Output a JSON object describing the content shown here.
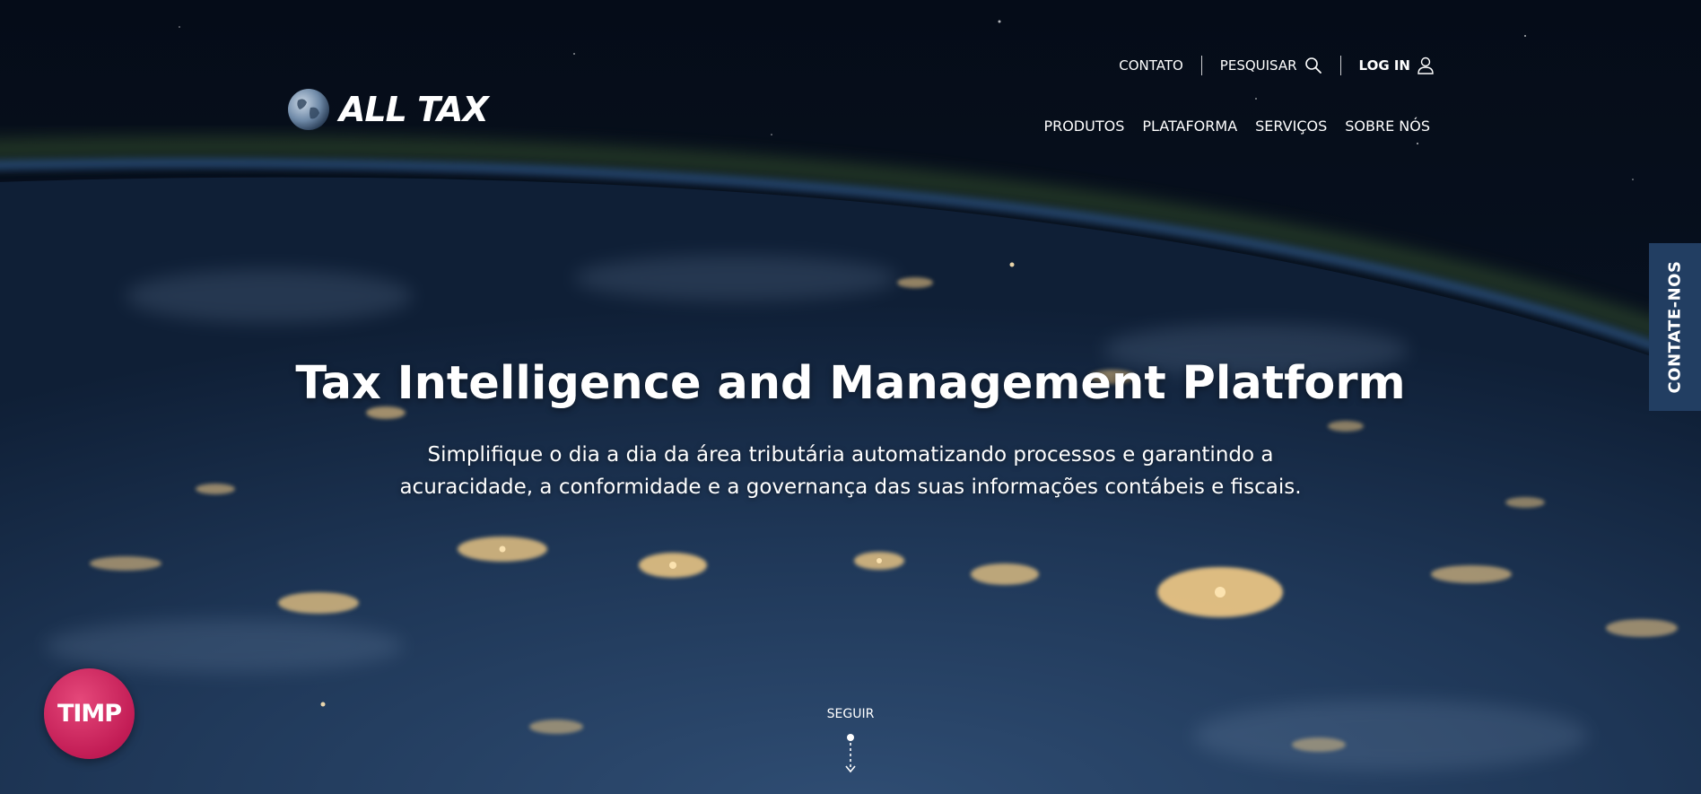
{
  "brand": {
    "name": "ALL TAX"
  },
  "util_nav": {
    "contact_label": "CONTATO",
    "search_label": "PESQUISAR",
    "login_label": "LOG IN"
  },
  "main_nav": {
    "items": [
      "PRODUTOS",
      "PLATAFORMA",
      "SERVIÇOS",
      "SOBRE NÓS"
    ]
  },
  "hero": {
    "title": "Tax Intelligence and Management Platform",
    "subtitle_line1": "Simplifique o dia a dia da área tributária automatizando processos e garantindo a",
    "subtitle_line2": "acuracidade, a conformidade e a governança das suas informações contábeis e fiscais."
  },
  "side_tab": {
    "label": "CONTATE-NOS"
  },
  "timp_badge": {
    "label": "TIMP"
  },
  "scroll_cue": {
    "label": "SEGUIR"
  },
  "colors": {
    "side_tab_bg": "#223e62",
    "timp_badge": "#c21c55",
    "sky": "#06101f"
  },
  "icons": {
    "search": "search-icon",
    "user": "user-icon",
    "globe": "globe-icon",
    "scroll": "scroll-down-icon"
  }
}
